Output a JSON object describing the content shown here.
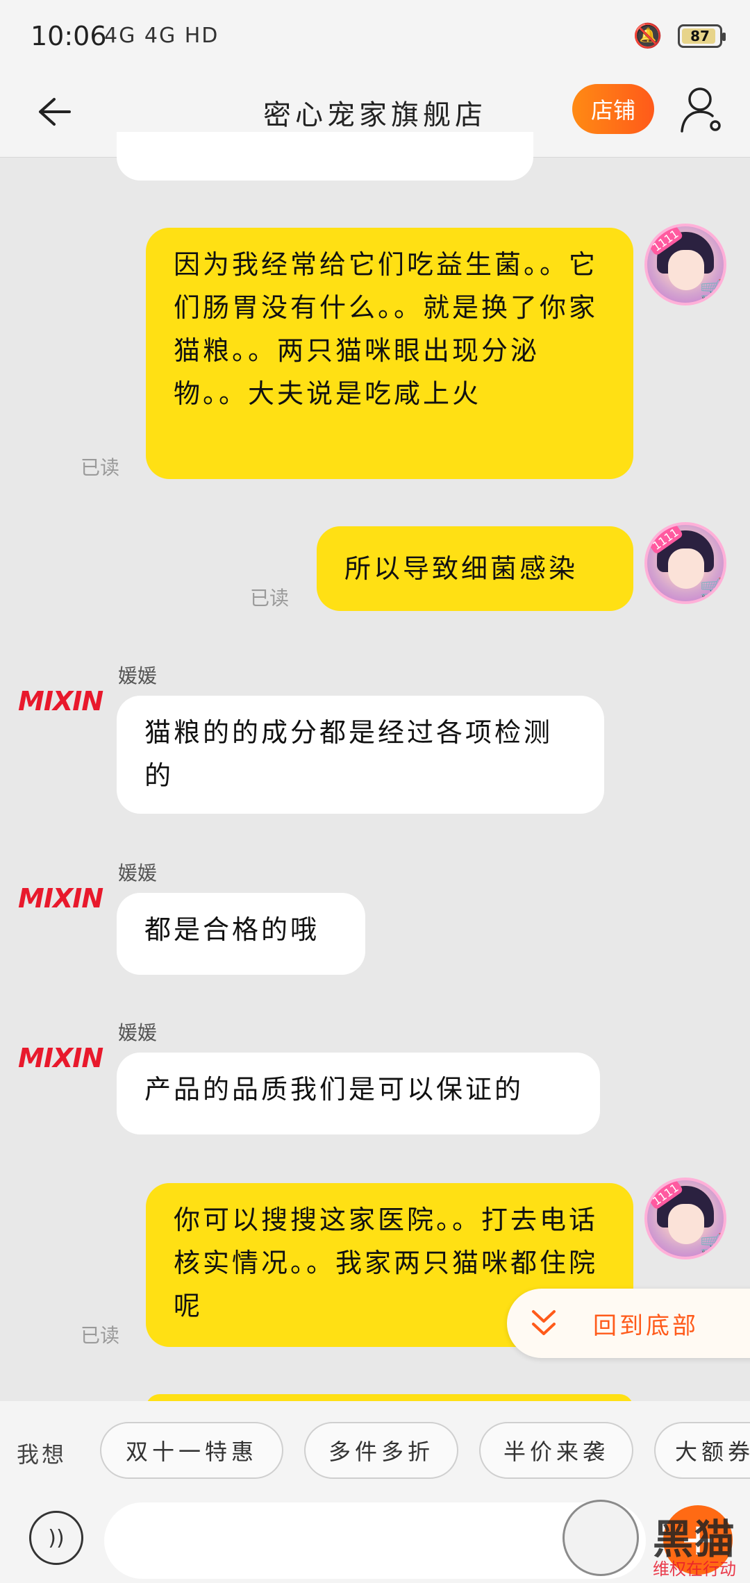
{
  "status_bar": {
    "time": "10:06",
    "signal_text": "4G   4G      HD",
    "battery": "87"
  },
  "header": {
    "title": "密心宠家旗舰店",
    "shop_button": "店铺"
  },
  "messages": [
    {
      "from": "me",
      "text": "因为我经常给它们吃益生菌。。它们肠胃没有什么。。就是换了你家猫粮。。两只猫咪眼出现分泌物。。大夫说是吃咸上火",
      "status": "已读"
    },
    {
      "from": "me",
      "text": "所以导致细菌感染",
      "status": "已读"
    },
    {
      "from": "shop",
      "name": "媛媛",
      "text": "猫粮的的成分都是经过各项检测的"
    },
    {
      "from": "shop",
      "name": "媛媛",
      "text": "都是合格的哦"
    },
    {
      "from": "shop",
      "name": "媛媛",
      "text": "产品的品质我们是可以保证的"
    },
    {
      "from": "me",
      "text": "你可以搜搜这家医院。。打去电话核实情况。。我家两只猫咪都住院呢",
      "status": "已读"
    }
  ],
  "shop_logo": "MIXIN",
  "avatar_tag": "1111",
  "back_to_bottom": "回到底部",
  "quick_replies": {
    "label": "我想",
    "chips": [
      "双十一特惠",
      "多件多折",
      "半价来袭",
      "大额券"
    ]
  },
  "input": {
    "placeholder": ""
  },
  "watermark": {
    "text": "黑猫",
    "sub": "维权在行动"
  },
  "colors": {
    "my_bubble": "#ffe014",
    "accent": "#ff6a14",
    "background": "#e8e8e8"
  }
}
